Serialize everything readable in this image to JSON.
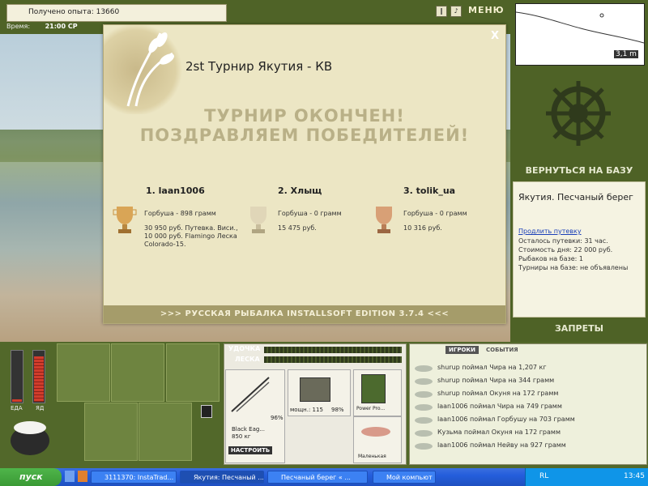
{
  "topbar": {
    "experience": "Получено опыта: 13660",
    "time_label": "Время:",
    "time_value": "21:00 СР",
    "pause_icon": "pause-icon",
    "sound_icon": "sound-icon",
    "menu_label": "МЕНЮ"
  },
  "dialog": {
    "title": "2st Турнир Якутия - КВ",
    "close_label": "X",
    "banner_line1": "ТУРНИР ОКОНЧЕН!",
    "banner_line2": "ПОЗДРАВЛЯЕМ ПОБЕДИТЕЛЕЙ!",
    "places": [
      {
        "name": "1. laan1006",
        "fish": "Горбуша - 898 грамм",
        "prize": "30 950 руб. Путевка. Виси., 10 000 руб. Flamingo Леска Colorado-15.",
        "cup": "gold"
      },
      {
        "name": "2. Хлыщ",
        "fish": "Горбуша - 0 грамм",
        "prize": "15 475 руб.",
        "cup": "silver"
      },
      {
        "name": "3. tolik_ua",
        "fish": "Горбуша - 0 грамм",
        "prize": "10 316 руб.",
        "cup": "bronze"
      }
    ],
    "footer": ">>> РУССКАЯ РЫБАЛКА INSTALLSOFT EDITION 3.7.4 <<<"
  },
  "map": {
    "depth": "3,1 m"
  },
  "right": {
    "return_base": "ВЕРНУТЬСЯ НА БАЗУ",
    "location_title": "Якутия. Песчаный берег",
    "extend_link": "Продлить путевку",
    "info": [
      "Осталось путевки: 31 час.",
      "Стоимость дня: 22 000 руб.",
      "Рыбаков на базе: 1",
      "Турниры на базе: не объявлены"
    ],
    "bans": "ЗАПРЕТЫ"
  },
  "status": {
    "food_label": "ЕДА",
    "poison_label": "ЯД",
    "food_level": 0.05,
    "poison_level": 0.9
  },
  "gear": {
    "rod_label": "УДОЧКА",
    "line_label": "ЛЕСКА",
    "rod_name": "Black Eag...",
    "rod_weight": "850 кг",
    "rod_pct": "96%",
    "reel_info": "мощн.: 115",
    "reel_pct": "98%",
    "line_name": "Power Pro...",
    "lure_name": "Маленькая",
    "setup_btn": "НАСТРОИТЬ"
  },
  "chat": {
    "tab_players": "ИГРОКИ",
    "tab_events": "СОБЫТИЯ",
    "lines": [
      "shurup поймал Чира на 1,207 кг",
      "shurup поймал Чира на 344 грамм",
      "shurup поймал Окуня на 172 грамм",
      "laan1006 поймал Чира на 749 грамм",
      "laan1006 поймал Горбушу на 703 грамм",
      "Кузьма поймал Окуня на 172 грамм",
      "laan1006 поймал Нейву на 927 грамм"
    ]
  },
  "taskbar": {
    "start": "пуск",
    "tasks": [
      "3111370: InstaTrad...",
      "Якутия: Песчаный ...",
      "Песчаный берег « ...",
      "Мой компьют"
    ],
    "lang": "RL",
    "clock": "13:45"
  },
  "colors": {
    "panel_green": "#4f6327",
    "dialog_bg": "#ece6c4",
    "banner_text": "#b9b087",
    "taskbar_blue": "#245edb"
  }
}
